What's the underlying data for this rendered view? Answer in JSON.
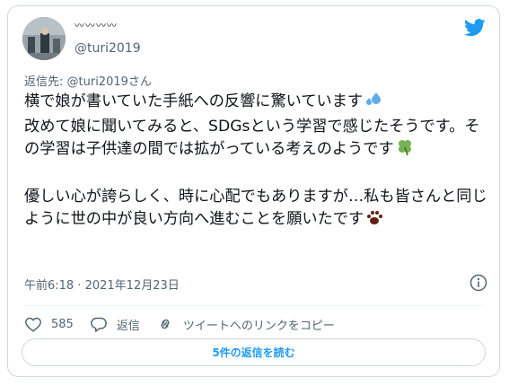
{
  "author": {
    "display_name": "〰〰〰〰",
    "handle": "@turi2019"
  },
  "reply_to": "返信先: @turi2019さん",
  "tweet": {
    "paragraph1": "横で娘が書いていた手紙への反響に驚いています",
    "paragraph1_emoji": "sweat-droplets-emoji",
    "paragraph2": "改めて娘に聞いてみると、SDGsという学習で感じたそうです。その学習は子供達の間では拡がっている考えのようです",
    "paragraph2_emoji": "four-leaf-clover-emoji",
    "paragraph3": "優しい心が誇らしく、時に心配でもありますが…私も皆さんと同じように世の中が良い方向へ進むことを願いたです",
    "paragraph3_emoji": "paw-prints-emoji"
  },
  "timestamp": "午前6:18 · 2021年12月23日",
  "actions": {
    "like_count": "585",
    "reply_label": "返信",
    "copy_link_label": "ツイートへのリンクをコピー"
  },
  "read_replies_label": "5件の返信を読む",
  "colors": {
    "brand": "#1d9bf0",
    "text": "#0f1419",
    "muted": "#536471",
    "border": "#cfd9de"
  },
  "icons": [
    "twitter-bird-icon",
    "info-icon",
    "heart-icon",
    "reply-icon",
    "link-icon"
  ]
}
